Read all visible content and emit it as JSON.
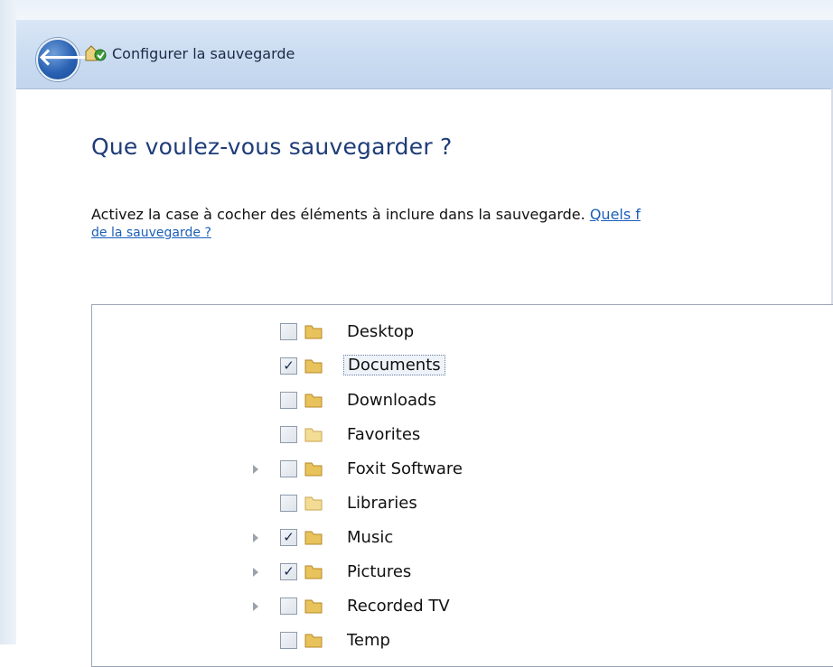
{
  "window": {
    "title": "Configurer la sauvegarde",
    "back_glyph": "🡐"
  },
  "main": {
    "heading": "Que voulez-vous sauvegarder ?",
    "instruction": "Activez la case à cocher des éléments à inclure dans la sauvegarde.",
    "help_link_part1": "Quels f",
    "help_link_part2": "de la sauvegarde ?"
  },
  "tree": {
    "items": [
      {
        "label": "Desktop",
        "checked": false,
        "expandable": false,
        "selected": false
      },
      {
        "label": "Documents",
        "checked": true,
        "expandable": false,
        "selected": true
      },
      {
        "label": "Downloads",
        "checked": false,
        "expandable": false,
        "selected": false
      },
      {
        "label": "Favorites",
        "checked": false,
        "expandable": false,
        "selected": false
      },
      {
        "label": "Foxit Software",
        "checked": false,
        "expandable": true,
        "selected": false
      },
      {
        "label": "Libraries",
        "checked": false,
        "expandable": false,
        "selected": false
      },
      {
        "label": "Music",
        "checked": true,
        "expandable": true,
        "selected": false
      },
      {
        "label": "Pictures",
        "checked": true,
        "expandable": true,
        "selected": false
      },
      {
        "label": "Recorded TV",
        "checked": false,
        "expandable": true,
        "selected": false
      },
      {
        "label": "Temp",
        "checked": false,
        "expandable": false,
        "selected": false
      }
    ],
    "check_glyph": "✓"
  },
  "colors": {
    "heading": "#1e3c78",
    "link": "#1b5fb8",
    "folder": "#e8c25a",
    "titlebar": "#c9dbf1"
  },
  "icons": {
    "back": "back-arrow-icon",
    "title": "backup-icon",
    "folder": "folder-icon",
    "expander": "expander-arrow-icon"
  }
}
